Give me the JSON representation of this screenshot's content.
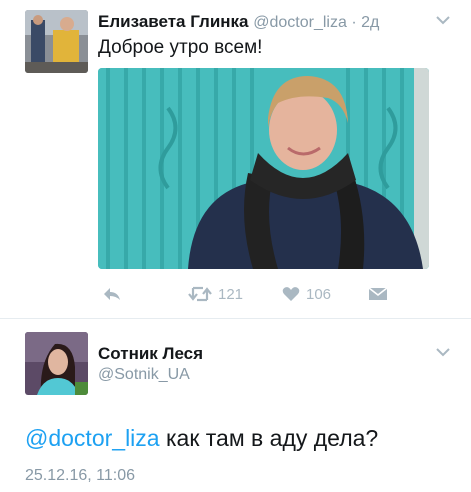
{
  "tweet1": {
    "author_name": "Елизавета Глинка",
    "author_handle": "@doctor_liza",
    "time_sep": " · ",
    "time": "2д",
    "text": "Доброе утро всем!",
    "retweets": "121",
    "likes": "106"
  },
  "tweet2": {
    "author_name": "Сотник Леся",
    "author_handle": "@Sotnik_UA",
    "mention": "@doctor_liza",
    "text": " как там в аду дела?",
    "timestamp": "25.12.16, 11:06"
  },
  "colors": {
    "link_blue": "#1da1f2",
    "secondary_gray": "#8899a6",
    "action_gray": "#aab8c2",
    "divider": "#e6ecf0"
  },
  "icons": [
    "reply-icon",
    "retweet-icon",
    "heart-icon",
    "dm-envelope-icon",
    "chevron-down-icon"
  ]
}
